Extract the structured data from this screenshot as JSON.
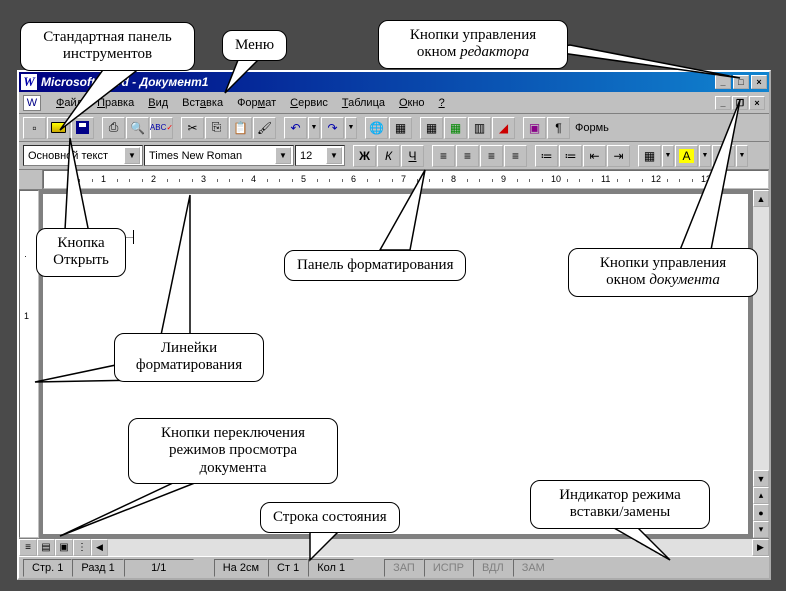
{
  "title": "Microsoft Word - Документ1",
  "menu": {
    "items": [
      "Файл",
      "Правка",
      "Вид",
      "Вставка",
      "Формат",
      "Сервис",
      "Таблица",
      "Окно",
      "?"
    ]
  },
  "standard_toolbar": {
    "label_forms": "Формь"
  },
  "format_toolbar": {
    "style": "Основной текст",
    "font": "Times New Roman",
    "size": "12",
    "bold": "Ж",
    "italic": "К",
    "underline": "Ч"
  },
  "ruler": {
    "numbers": [
      "1",
      "2",
      "3",
      "4",
      "5",
      "6",
      "7",
      "8",
      "9",
      "10",
      "11",
      "12",
      "13"
    ]
  },
  "status": {
    "page": "Стр. 1",
    "section": "Разд 1",
    "pages": "1/1",
    "at": "На 2см",
    "line": "Ст 1",
    "col": "Кол 1",
    "rec": "ЗАП",
    "trk": "ИСПР",
    "ext": "ВДЛ",
    "ovr": "ЗАМ"
  },
  "callouts": {
    "std_toolbar": "Стандартная панель\nинструментов",
    "menu": "Меню",
    "editor_buttons_l1": "Кнопки управления",
    "editor_buttons_l2": "окном ",
    "editor_buttons_em": "редактора",
    "open_button": "Кнопка\nОткрыть",
    "format_panel": "Панель форматирования",
    "doc_buttons_l1": "Кнопки управления",
    "doc_buttons_l2": "окном ",
    "doc_buttons_em": "документа",
    "rulers": "Линейки\nформатирования",
    "view_modes": "Кнопки переключения\nрежимов просмотра\nдокумента",
    "status_line": "Строка состояния",
    "ovr_indicator": "Индикатор режима\nвставки/замены"
  }
}
